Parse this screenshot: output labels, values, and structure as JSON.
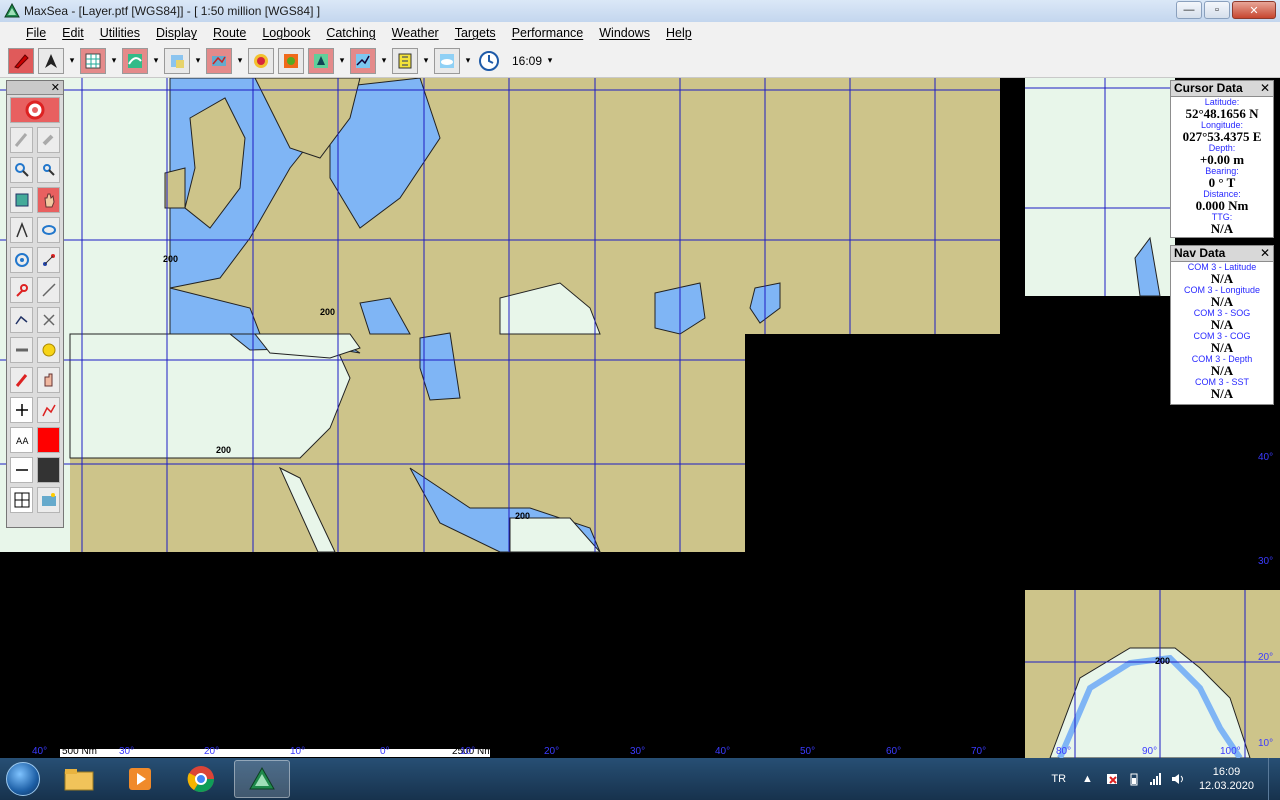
{
  "window": {
    "title": "MaxSea - [Layer.ptf [WGS84]] - [ 1:50 million [WGS84] ]",
    "buttons": {
      "minimize": "—",
      "maximize": "▫",
      "close": "✕"
    }
  },
  "menu": [
    "File",
    "Edit",
    "Utilities",
    "Display",
    "Route",
    "Logbook",
    "Catching",
    "Weather",
    "Targets",
    "Performance",
    "Windows",
    "Help"
  ],
  "toolbar": {
    "time": "16:09",
    "icons": [
      "pencil-icon",
      "north-arrow-icon",
      "grid-icon",
      "weather-map-icon",
      "chart-icon",
      "layers-icon",
      "contour-icon",
      "heatmap-icon",
      "target-icon",
      "route-icon",
      "measure-icon",
      "cloud-icon",
      "clock-icon"
    ]
  },
  "map": {
    "colors": {
      "land": "#cdc48a",
      "shallow": "#7fb5f5",
      "deep": "#e8f6ea",
      "grid": "#1c1cc4",
      "void": "#000000"
    },
    "depth_labels": [
      "200",
      "200",
      "200",
      "200",
      "200"
    ],
    "lat_labels": [
      "40°",
      "30°",
      "20°",
      "10°"
    ],
    "lon_labels": [
      "40°",
      "30°",
      "20°",
      "10°",
      "0°",
      "10°",
      "20°",
      "30°",
      "40°",
      "50°",
      "60°",
      "70°",
      "80°",
      "90°",
      "100°"
    ],
    "scale": {
      "left": "500 Nm",
      "right": "2500 Nm"
    }
  },
  "palette": {
    "close": "✕",
    "tools": [
      "lifebuoy-icon",
      "pen-icon",
      "zoom-in-icon",
      "zoom-out-icon",
      "pan-icon",
      "hand-icon",
      "compass-icon",
      "lasso-icon",
      "target-icon",
      "waypoint-icon",
      "route-icon",
      "line-icon",
      "plot-icon",
      "scissors-icon",
      "ruler-icon",
      "emoji-icon",
      "pencil-icon",
      "finger-icon",
      "crosshair-icon",
      "chart-icon",
      "text-icon",
      "color-icon",
      "line-style-icon",
      "hatch-icon",
      "numbers-icon",
      "image-icon"
    ]
  },
  "cursor_data": {
    "title": "Cursor Data",
    "close": "✕",
    "fields": [
      {
        "label": "Latitude:",
        "value": "52°48.1656 N"
      },
      {
        "label": "Longitude:",
        "value": "027°53.4375 E"
      },
      {
        "label": "Depth:",
        "value": "+0.00 m"
      },
      {
        "label": "Bearing:",
        "value": "0 ° T"
      },
      {
        "label": "Distance:",
        "value": "0.000 Nm"
      },
      {
        "label": "TTG:",
        "value": "N/A"
      }
    ]
  },
  "nav_data": {
    "title": "Nav Data",
    "close": "✕",
    "fields": [
      {
        "label": "COM 3 - Latitude",
        "value": "N/A"
      },
      {
        "label": "COM 3 - Longitude",
        "value": "N/A"
      },
      {
        "label": "COM 3 - SOG",
        "value": "N/A"
      },
      {
        "label": "COM 3 - COG",
        "value": "N/A"
      },
      {
        "label": "COM 3 - Depth",
        "value": "N/A"
      },
      {
        "label": "COM 3 - SST",
        "value": "N/A"
      }
    ]
  },
  "taskbar": {
    "apps": [
      "file-explorer-icon",
      "media-player-icon",
      "chrome-icon",
      "maxsea-icon"
    ],
    "lang": "TR",
    "time": "16:09",
    "date": "12.03.2020"
  }
}
